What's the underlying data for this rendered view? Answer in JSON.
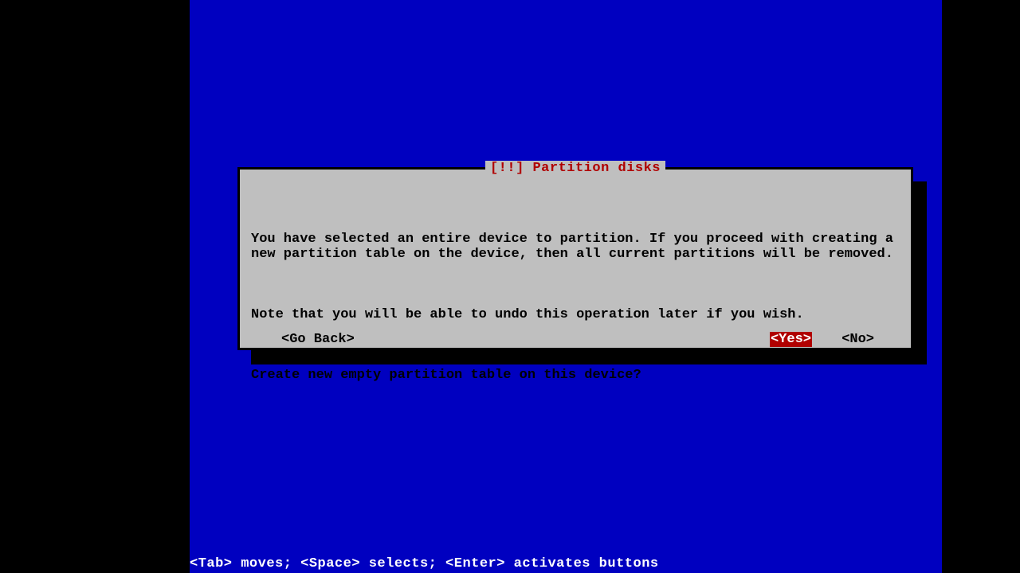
{
  "dialog": {
    "title": "[!!] Partition disks",
    "paragraph1": "You have selected an entire device to partition. If you proceed with creating a new partition table on the device, then all current partitions will be removed.",
    "paragraph2": "Note that you will be able to undo this operation later if you wish.",
    "question": "Create new empty partition table on this device?",
    "buttons": {
      "go_back": "<Go Back>",
      "yes": "<Yes>",
      "no": "<No>"
    },
    "selected_button": "yes"
  },
  "help_line": "<Tab> moves; <Space> selects; <Enter> activates buttons"
}
